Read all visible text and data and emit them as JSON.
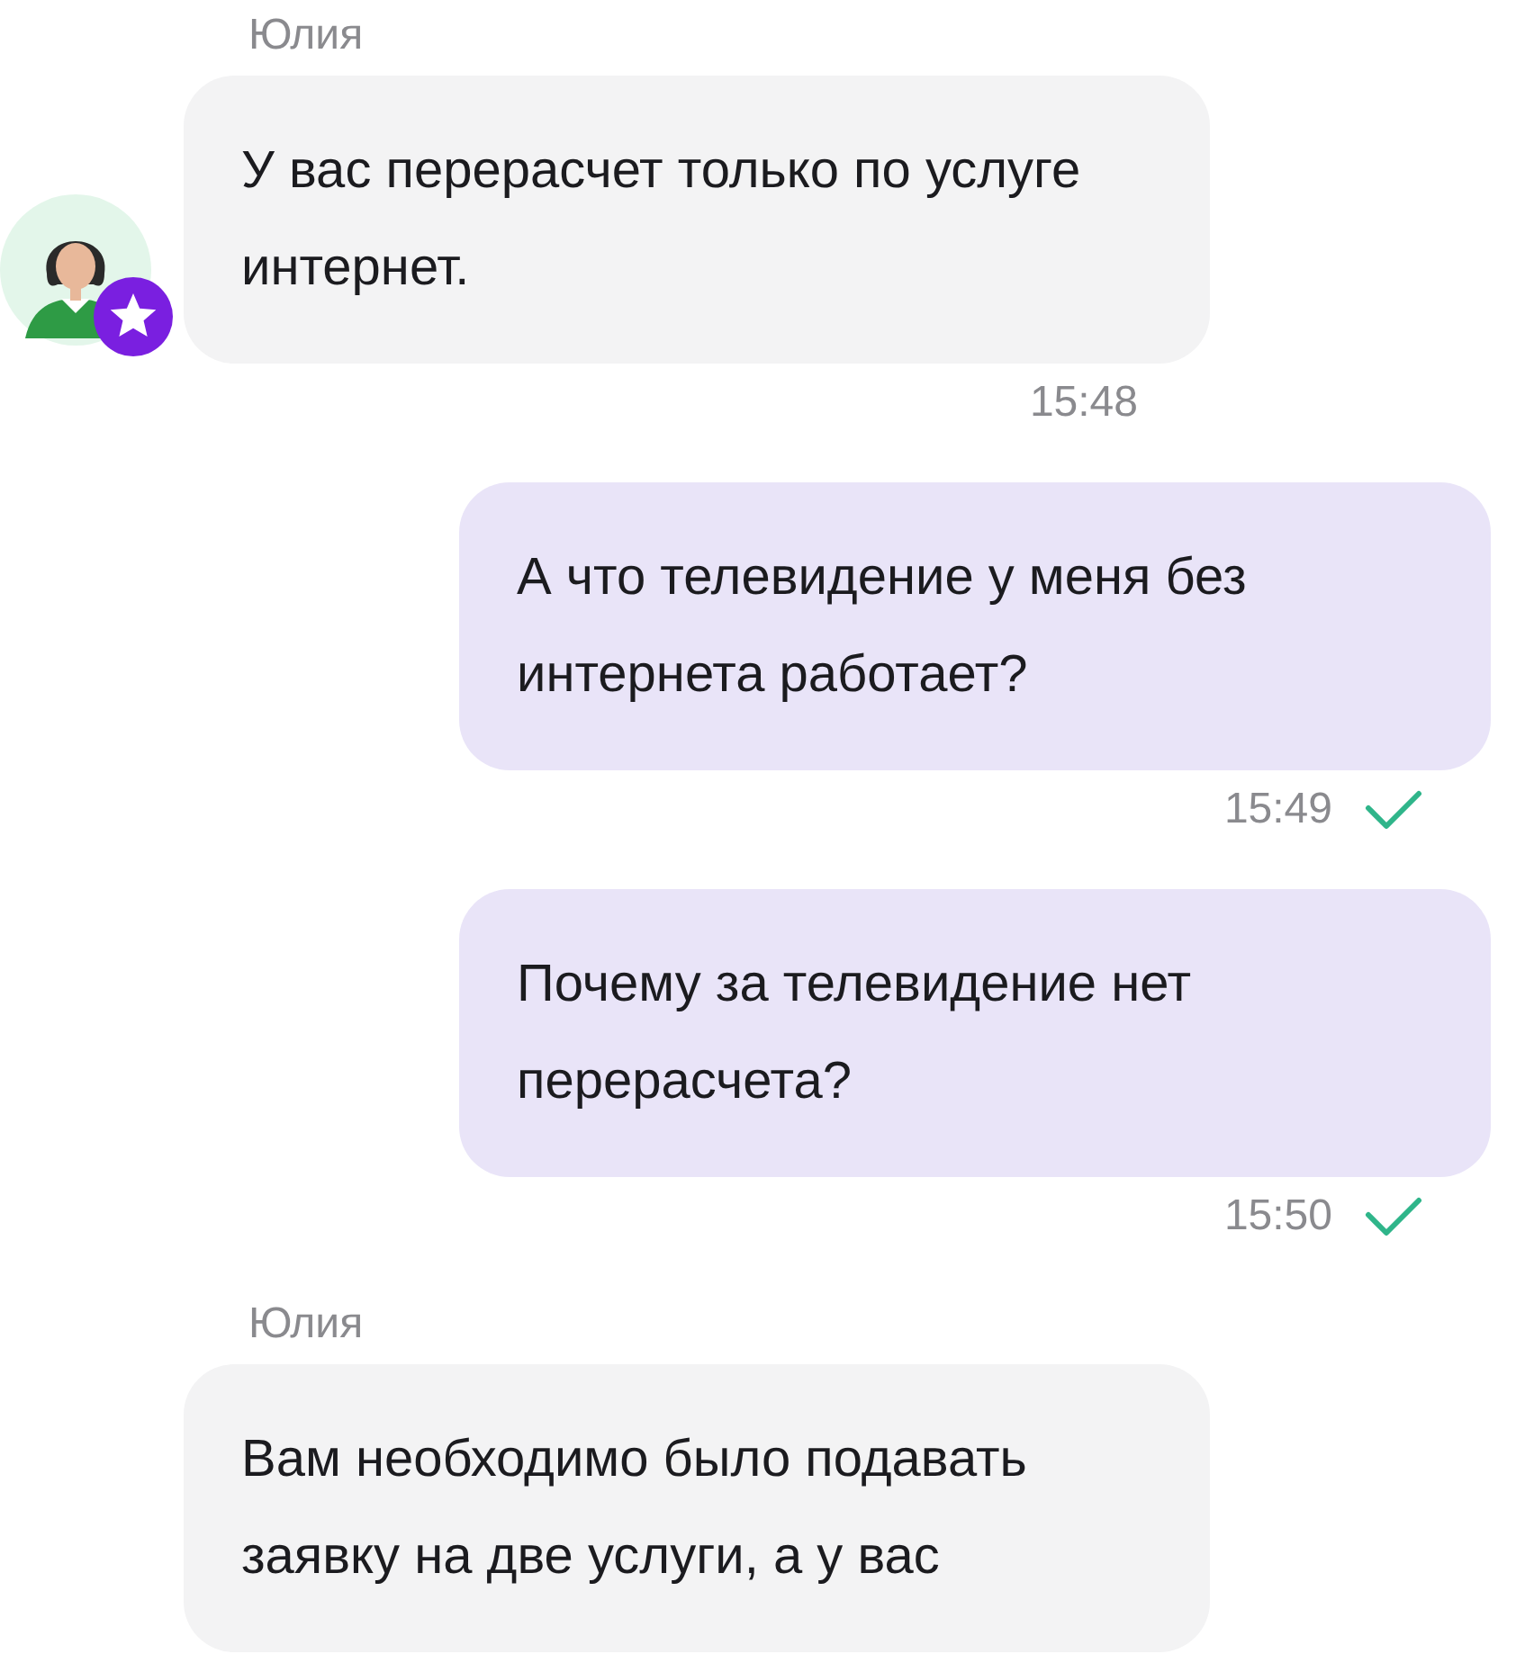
{
  "messages": [
    {
      "kind": "incoming",
      "sender": "Юлия",
      "text": "У вас перерасчет только по услуге интернет.",
      "time": "15:48",
      "avatar": true
    },
    {
      "kind": "outgoing",
      "text": "А что телевидение у меня без интернета работает?",
      "time": "15:49",
      "delivered": true
    },
    {
      "kind": "outgoing",
      "text": "Почему за телевидение нет перерасчета?",
      "time": "15:50",
      "delivered": true
    },
    {
      "kind": "incoming",
      "sender": "Юлия",
      "text": "Вам необходимо было подавать заявку на две услуги, а у вас",
      "avatar": false
    }
  ]
}
